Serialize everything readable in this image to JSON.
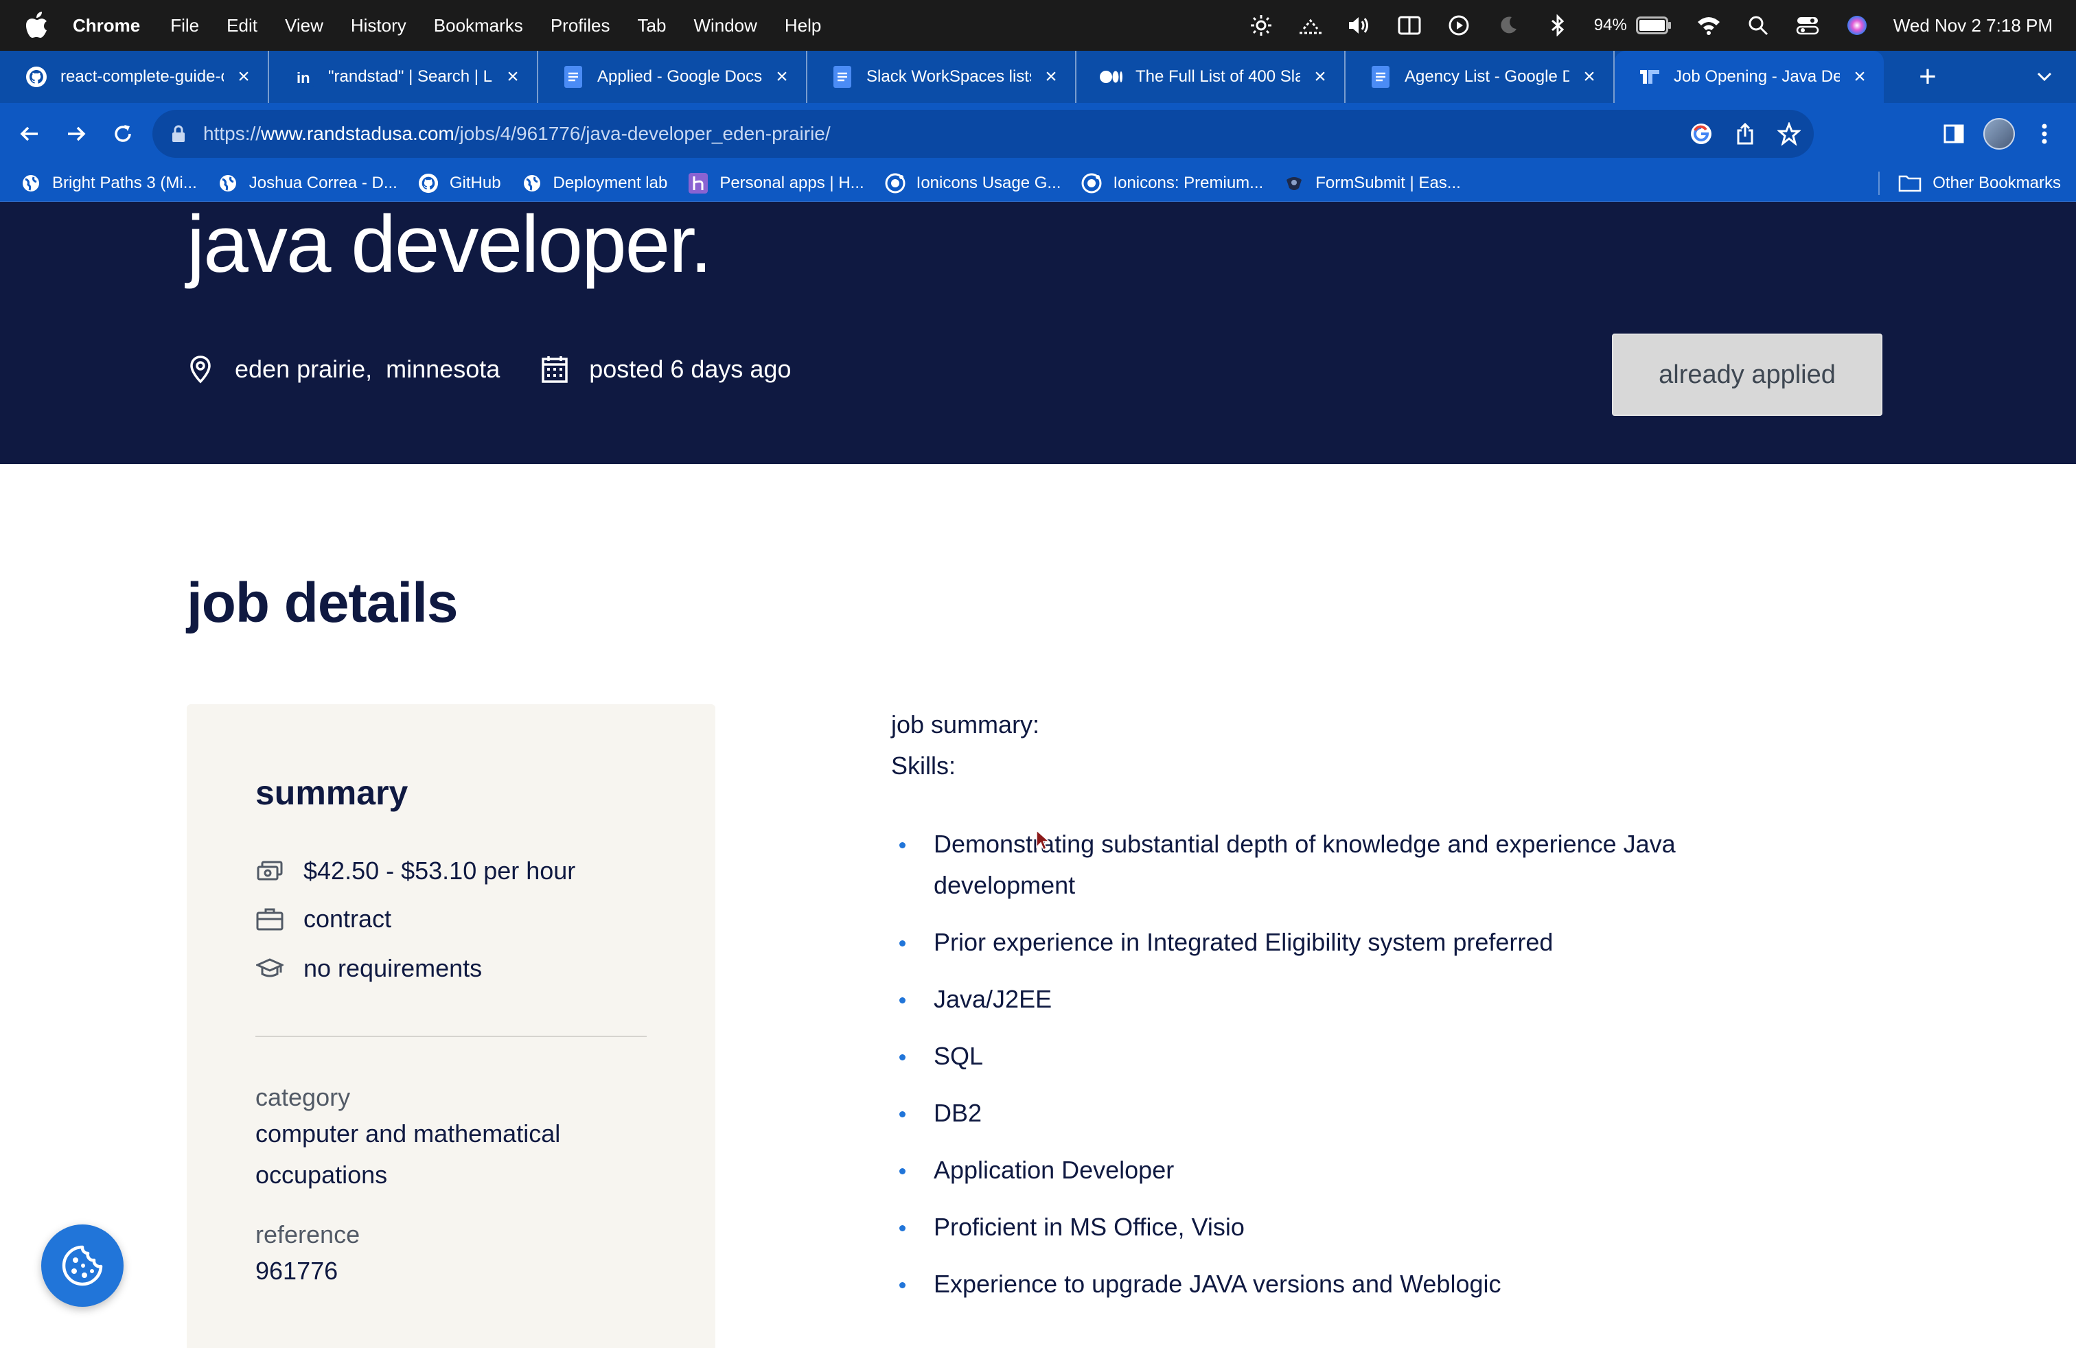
{
  "menubar": {
    "app_name": "Chrome",
    "menus": [
      "File",
      "Edit",
      "View",
      "History",
      "Bookmarks",
      "Profiles",
      "Tab",
      "Window",
      "Help"
    ],
    "battery": "94%",
    "clock": "Wed Nov 2  7:18 PM",
    "status_icons": [
      "brightness-icon",
      "screen-icon",
      "volume-icon",
      "mirror-icon",
      "play-icon",
      "moon-icon",
      "bluetooth-icon",
      "battery-icon",
      "wifi-icon",
      "search-icon",
      "control-center-icon",
      "siri-icon"
    ]
  },
  "tabs": [
    {
      "title": "react-complete-guide-c",
      "icon": "github-icon",
      "active": false
    },
    {
      "title": "\"randstad\" | Search | Li",
      "icon": "linkedin-icon",
      "active": false
    },
    {
      "title": "Applied - Google Docs",
      "icon": "docs-icon",
      "active": false
    },
    {
      "title": "Slack WorkSpaces lists",
      "icon": "docs-icon",
      "active": false
    },
    {
      "title": "The Full List of 400 Sla",
      "icon": "medium-icon",
      "active": false
    },
    {
      "title": "Agency List - Google D",
      "icon": "docs-icon",
      "active": false
    },
    {
      "title": "Job Opening - Java Dev",
      "icon": "randstad-icon",
      "active": true
    }
  ],
  "address_bar": {
    "scheme": "https://",
    "domain": "www.randstadusa.com",
    "path": "/jobs/4/961776/java-developer_eden-prairie/"
  },
  "bookmarks": [
    {
      "label": "Bright Paths 3 (Mi...",
      "icon": "globe-icon"
    },
    {
      "label": "Joshua Correa - D...",
      "icon": "globe-icon"
    },
    {
      "label": "GitHub",
      "icon": "github-icon"
    },
    {
      "label": "Deployment lab",
      "icon": "globe-icon"
    },
    {
      "label": "Personal apps | H...",
      "icon": "heroku-icon"
    },
    {
      "label": "Ionicons Usage G...",
      "icon": "ionicons-icon"
    },
    {
      "label": "Ionicons: Premium...",
      "icon": "ionicons-icon"
    },
    {
      "label": "FormSubmit | Eas...",
      "icon": "formsubmit-icon"
    }
  ],
  "other_bookmarks": "Other Bookmarks",
  "job": {
    "title": "java developer.",
    "city": "eden prairie,",
    "state": "minnesota",
    "posted": "posted 6 days ago",
    "applied_button": "already applied"
  },
  "details": {
    "heading": "job details",
    "summary_title": "summary",
    "pay": "$42.50 - $53.10 per hour",
    "job_type": "contract",
    "education": "no requirements",
    "category_label": "category",
    "category_value": "computer and mathematical occupations",
    "reference_label": "reference",
    "reference_value": "961776"
  },
  "description": {
    "summary_line": "job summary:",
    "skills_line": "Skills:",
    "skills": [
      "Demonstrating substantial depth of knowledge and experience  Java development",
      "Prior experience in Integrated Eligibility system preferred",
      "Java/J2EE",
      "SQL",
      "DB2",
      "Application Developer",
      "Proficient in MS Office, Visio",
      "Experience to upgrade JAVA versions and Weblogic"
    ]
  },
  "colors": {
    "hero_bg": "#0f1941",
    "chrome_blue": "#0e58c2",
    "accent": "#2175d9",
    "card_bg": "#f7f5f0"
  }
}
